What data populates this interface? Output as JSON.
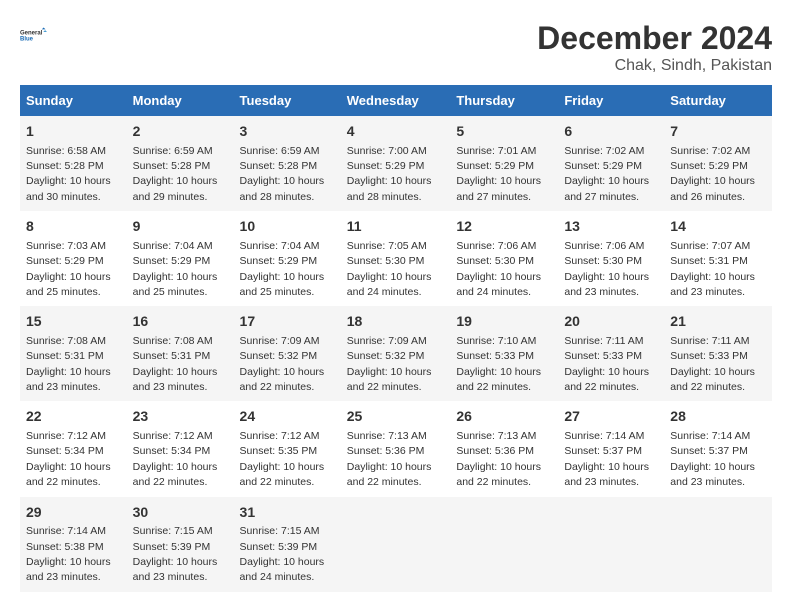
{
  "logo": {
    "line1": "General",
    "line2": "Blue"
  },
  "title": "December 2024",
  "subtitle": "Chak, Sindh, Pakistan",
  "headers": [
    "Sunday",
    "Monday",
    "Tuesday",
    "Wednesday",
    "Thursday",
    "Friday",
    "Saturday"
  ],
  "weeks": [
    [
      {
        "day": "1",
        "info": "Sunrise: 6:58 AM\nSunset: 5:28 PM\nDaylight: 10 hours and 30 minutes."
      },
      {
        "day": "2",
        "info": "Sunrise: 6:59 AM\nSunset: 5:28 PM\nDaylight: 10 hours and 29 minutes."
      },
      {
        "day": "3",
        "info": "Sunrise: 6:59 AM\nSunset: 5:28 PM\nDaylight: 10 hours and 28 minutes."
      },
      {
        "day": "4",
        "info": "Sunrise: 7:00 AM\nSunset: 5:29 PM\nDaylight: 10 hours and 28 minutes."
      },
      {
        "day": "5",
        "info": "Sunrise: 7:01 AM\nSunset: 5:29 PM\nDaylight: 10 hours and 27 minutes."
      },
      {
        "day": "6",
        "info": "Sunrise: 7:02 AM\nSunset: 5:29 PM\nDaylight: 10 hours and 27 minutes."
      },
      {
        "day": "7",
        "info": "Sunrise: 7:02 AM\nSunset: 5:29 PM\nDaylight: 10 hours and 26 minutes."
      }
    ],
    [
      {
        "day": "8",
        "info": "Sunrise: 7:03 AM\nSunset: 5:29 PM\nDaylight: 10 hours and 25 minutes."
      },
      {
        "day": "9",
        "info": "Sunrise: 7:04 AM\nSunset: 5:29 PM\nDaylight: 10 hours and 25 minutes."
      },
      {
        "day": "10",
        "info": "Sunrise: 7:04 AM\nSunset: 5:29 PM\nDaylight: 10 hours and 25 minutes."
      },
      {
        "day": "11",
        "info": "Sunrise: 7:05 AM\nSunset: 5:30 PM\nDaylight: 10 hours and 24 minutes."
      },
      {
        "day": "12",
        "info": "Sunrise: 7:06 AM\nSunset: 5:30 PM\nDaylight: 10 hours and 24 minutes."
      },
      {
        "day": "13",
        "info": "Sunrise: 7:06 AM\nSunset: 5:30 PM\nDaylight: 10 hours and 23 minutes."
      },
      {
        "day": "14",
        "info": "Sunrise: 7:07 AM\nSunset: 5:31 PM\nDaylight: 10 hours and 23 minutes."
      }
    ],
    [
      {
        "day": "15",
        "info": "Sunrise: 7:08 AM\nSunset: 5:31 PM\nDaylight: 10 hours and 23 minutes."
      },
      {
        "day": "16",
        "info": "Sunrise: 7:08 AM\nSunset: 5:31 PM\nDaylight: 10 hours and 23 minutes."
      },
      {
        "day": "17",
        "info": "Sunrise: 7:09 AM\nSunset: 5:32 PM\nDaylight: 10 hours and 22 minutes."
      },
      {
        "day": "18",
        "info": "Sunrise: 7:09 AM\nSunset: 5:32 PM\nDaylight: 10 hours and 22 minutes."
      },
      {
        "day": "19",
        "info": "Sunrise: 7:10 AM\nSunset: 5:33 PM\nDaylight: 10 hours and 22 minutes."
      },
      {
        "day": "20",
        "info": "Sunrise: 7:11 AM\nSunset: 5:33 PM\nDaylight: 10 hours and 22 minutes."
      },
      {
        "day": "21",
        "info": "Sunrise: 7:11 AM\nSunset: 5:33 PM\nDaylight: 10 hours and 22 minutes."
      }
    ],
    [
      {
        "day": "22",
        "info": "Sunrise: 7:12 AM\nSunset: 5:34 PM\nDaylight: 10 hours and 22 minutes."
      },
      {
        "day": "23",
        "info": "Sunrise: 7:12 AM\nSunset: 5:34 PM\nDaylight: 10 hours and 22 minutes."
      },
      {
        "day": "24",
        "info": "Sunrise: 7:12 AM\nSunset: 5:35 PM\nDaylight: 10 hours and 22 minutes."
      },
      {
        "day": "25",
        "info": "Sunrise: 7:13 AM\nSunset: 5:36 PM\nDaylight: 10 hours and 22 minutes."
      },
      {
        "day": "26",
        "info": "Sunrise: 7:13 AM\nSunset: 5:36 PM\nDaylight: 10 hours and 22 minutes."
      },
      {
        "day": "27",
        "info": "Sunrise: 7:14 AM\nSunset: 5:37 PM\nDaylight: 10 hours and 23 minutes."
      },
      {
        "day": "28",
        "info": "Sunrise: 7:14 AM\nSunset: 5:37 PM\nDaylight: 10 hours and 23 minutes."
      }
    ],
    [
      {
        "day": "29",
        "info": "Sunrise: 7:14 AM\nSunset: 5:38 PM\nDaylight: 10 hours and 23 minutes."
      },
      {
        "day": "30",
        "info": "Sunrise: 7:15 AM\nSunset: 5:39 PM\nDaylight: 10 hours and 23 minutes."
      },
      {
        "day": "31",
        "info": "Sunrise: 7:15 AM\nSunset: 5:39 PM\nDaylight: 10 hours and 24 minutes."
      },
      {
        "day": "",
        "info": ""
      },
      {
        "day": "",
        "info": ""
      },
      {
        "day": "",
        "info": ""
      },
      {
        "day": "",
        "info": ""
      }
    ]
  ]
}
